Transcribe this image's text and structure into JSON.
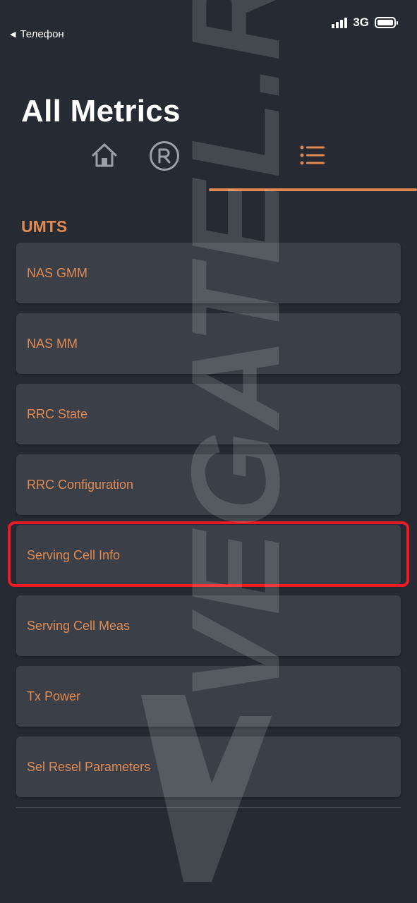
{
  "status_bar": {
    "back_label": "Телефон",
    "network": "3G",
    "signal_bars": 4
  },
  "header": {
    "title": "All Metrics"
  },
  "tabs": [
    {
      "icon": "home-icon",
      "active": false
    },
    {
      "icon": "registered-icon",
      "active": false
    },
    {
      "icon": "list-icon",
      "active": true
    }
  ],
  "section": {
    "title": "UMTS",
    "items": [
      {
        "label": "NAS GMM"
      },
      {
        "label": "NAS MM"
      },
      {
        "label": "RRC State"
      },
      {
        "label": "RRC Configuration"
      },
      {
        "label": "Serving Cell Info",
        "highlighted": true
      },
      {
        "label": "Serving Cell Meas"
      },
      {
        "label": "Tx Power"
      },
      {
        "label": "Sel Resel Parameters"
      }
    ]
  },
  "watermark": {
    "text": "VEGATEL.RU"
  },
  "colors": {
    "background": "#262a33",
    "card": "#3b3f48",
    "accent": "#e08a52",
    "highlight": "#ec1b23"
  }
}
